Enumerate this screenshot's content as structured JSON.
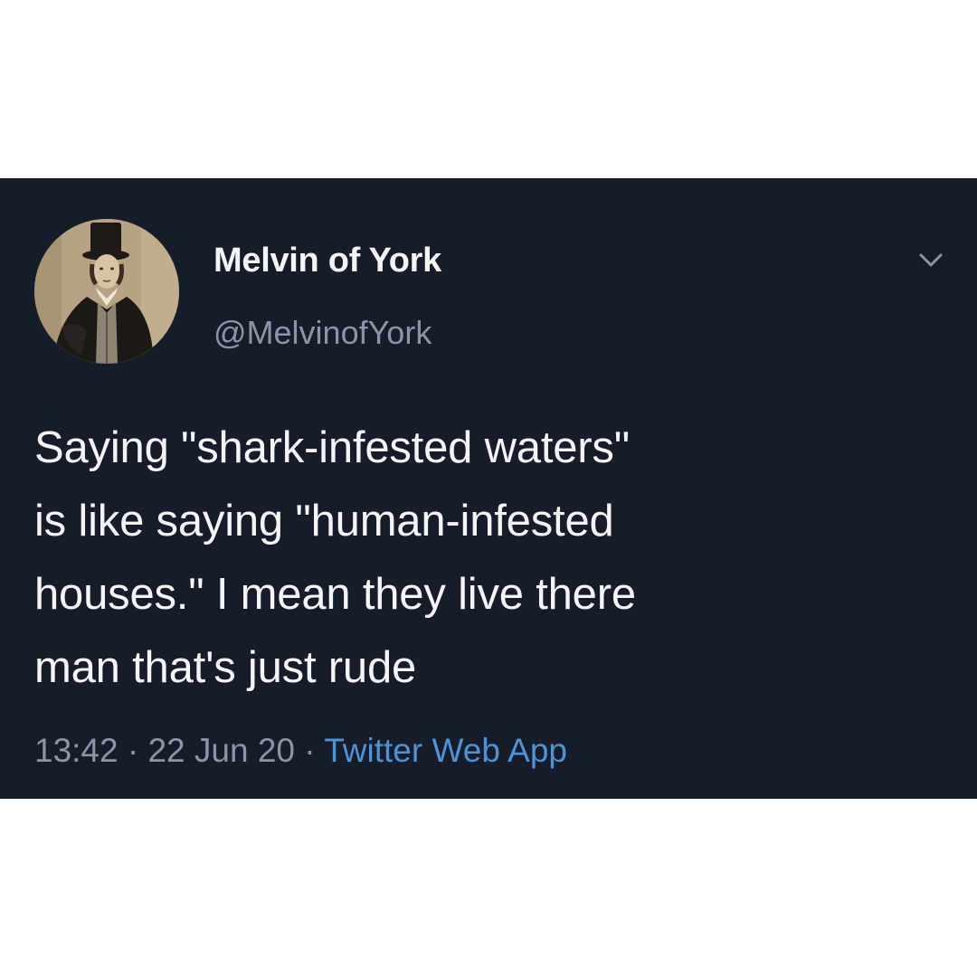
{
  "tweet": {
    "author": {
      "name": "Melvin of York",
      "handle": "@MelvinofYork",
      "avatar": "avatar"
    },
    "menu_icon": "chevron-down-icon",
    "text_lines": [
      "Saying \"shark-infested waters\"",
      "is like saying \"human-infested",
      "houses.\" I mean they live there",
      "man that's just rude"
    ],
    "time": "13:42",
    "separator": "·",
    "date": "22 Jun 20",
    "source": "Twitter Web App"
  },
  "colors": {
    "card_background": "#161c2a",
    "text_primary": "#f3f5f7",
    "text_secondary": "#8a96a3",
    "link": "#4f93d2",
    "page_background": "#ffffff"
  }
}
